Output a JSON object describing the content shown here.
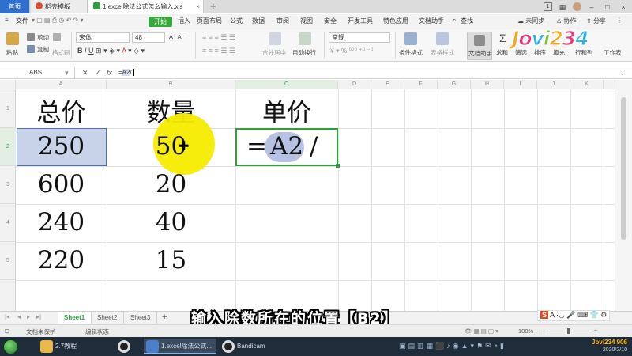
{
  "tabs": {
    "home": "首页",
    "template": "稻壳模板",
    "document": "1.excel除法公式怎么输入.xls",
    "page_indicator": "1"
  },
  "menu": {
    "file": "文件",
    "start": "开始",
    "items": [
      "插入",
      "页面布局",
      "公式",
      "数据",
      "审阅",
      "视图",
      "安全",
      "开发工具",
      "特色应用",
      "文档助手"
    ],
    "search": "查找",
    "sync": "未同步",
    "collab": "协作",
    "share": "分享"
  },
  "ribbon": {
    "paste": "粘贴",
    "cut": "剪切",
    "copy": "复制",
    "format_painter": "格式刷",
    "font_name": "宋体",
    "font_size": "48",
    "merge_center": "合并居中",
    "auto_wrap": "自动换行",
    "number_format": "常规",
    "conditional_format": "条件格式",
    "table_style": "表格样式",
    "doc_helper": "文档助手",
    "sum": "求和",
    "filter": "筛选",
    "sort": "排序",
    "fill": "填充",
    "rows_cols": "行和列",
    "worksheet": "工作表"
  },
  "logo": {
    "text": "Jovi234",
    "small_text": "Jovi234",
    "small_number": "906"
  },
  "formula_bar": {
    "name_box": "ABS",
    "cancel": "✕",
    "confirm": "✓",
    "fx": "fx",
    "formula_eq": "=",
    "formula_ref": "A2",
    "formula_op": "/"
  },
  "grid": {
    "columns": [
      "A",
      "B",
      "C",
      "D",
      "E",
      "F",
      "G",
      "H",
      "I",
      "J",
      "K"
    ],
    "rows": [
      "1",
      "2",
      "3",
      "4",
      "5"
    ],
    "header": [
      "总价",
      "数量",
      "单价"
    ],
    "data": [
      [
        "250",
        "50"
      ],
      [
        "600",
        "20"
      ],
      [
        "240",
        "40"
      ],
      [
        "220",
        "15"
      ]
    ],
    "c2_eq": "=",
    "c2_ref": "A2",
    "c2_op": "/"
  },
  "sheets": [
    "Sheet1",
    "Sheet2",
    "Sheet3"
  ],
  "sheet_add": "+",
  "status": {
    "protect": "文档未保护",
    "mode": "编辑状态",
    "zoom": "100%"
  },
  "subtitle": "输入除数所在的位置【B2】",
  "taskbar": {
    "folder": "2.7教程",
    "wps": "1.excel除法公式...",
    "bandicam": "Bandicam",
    "date": "2020/2/10"
  },
  "colors": {
    "accent_green": "#2f9e3f",
    "home_blue": "#2f6fce",
    "selection_fill": "#c8d2e8",
    "highlight_yellow": "#f6ec00"
  }
}
